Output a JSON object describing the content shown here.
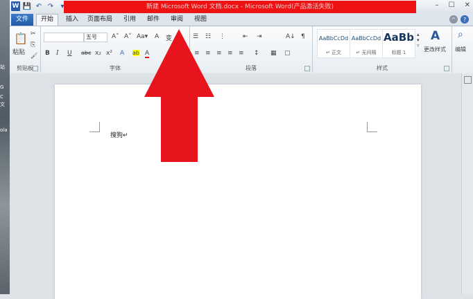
{
  "window": {
    "title": "新建 Microsoft Word 文档.docx - Microsoft Word(产品激活失败)"
  },
  "desktop": {
    "labels": [
      "站",
      "G",
      "C",
      "文",
      "ola"
    ]
  },
  "qat": {
    "logo": "W",
    "save": "💾",
    "undo": "↶",
    "redo": "↷",
    "more": "▾"
  },
  "window_controls": {
    "minimize": "–",
    "maximize": "☐",
    "close": "✕"
  },
  "tabs": [
    "文件",
    "开始",
    "插入",
    "页面布局",
    "引用",
    "邮件",
    "审阅",
    "视图"
  ],
  "help_icons": {
    "ribbon_toggle": "^",
    "help": "?"
  },
  "ribbon": {
    "clipboard": {
      "label": "剪贴板",
      "paste": "粘贴",
      "cut": "✂",
      "copy": "⎘",
      "format_painter": "🖌"
    },
    "font": {
      "label": "字体",
      "font_name": "",
      "font_size": "五号",
      "grow": "A˄",
      "shrink": "A˅",
      "case": "Aa▾",
      "clear": "A",
      "phonetic": "变",
      "bold": "B",
      "italic": "I",
      "underline": "U",
      "strike": "abc",
      "sub": "x₂",
      "sup": "x²",
      "effects": "A",
      "highlight": "ab",
      "color": "A"
    },
    "paragraph": {
      "label": "段落",
      "bullets": "☰",
      "numbering": "☷",
      "multilevel": "⋮",
      "dec_indent": "⇤",
      "inc_indent": "⇥",
      "sort": "A↓",
      "marks": "¶",
      "align_left": "≡",
      "center": "≡",
      "align_right": "≡",
      "justify": "≡",
      "distributed": "≡",
      "spacing": "↕",
      "shading": "▦",
      "borders": "▢"
    },
    "styles": {
      "label": "样式",
      "items": [
        {
          "preview": "AaBbCcDd",
          "name": "↵ 正文"
        },
        {
          "preview": "AaBbCcDd",
          "name": "↵ 无间隔"
        },
        {
          "preview": "AaBb",
          "name": "标题 1"
        }
      ],
      "change_styles": "更改样式"
    },
    "editing": {
      "label": "编辑"
    }
  },
  "document": {
    "text": "搜狗↵"
  }
}
